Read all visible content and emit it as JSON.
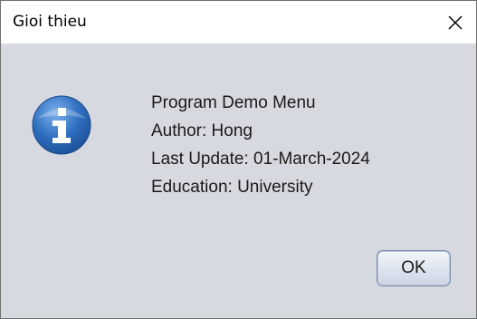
{
  "window": {
    "title": "Gioi thieu",
    "close_icon": "close-icon"
  },
  "message": {
    "icon": "info-icon",
    "lines": [
      "Program Demo Menu",
      "Author: Hong",
      "Last Update: 01-March-2024",
      "Education: University"
    ]
  },
  "buttons": {
    "ok_label": "OK"
  },
  "colors": {
    "dialog_background": "#d6d9df",
    "titlebar_background": "#ffffff",
    "icon_blue": "#2f6fbf"
  }
}
